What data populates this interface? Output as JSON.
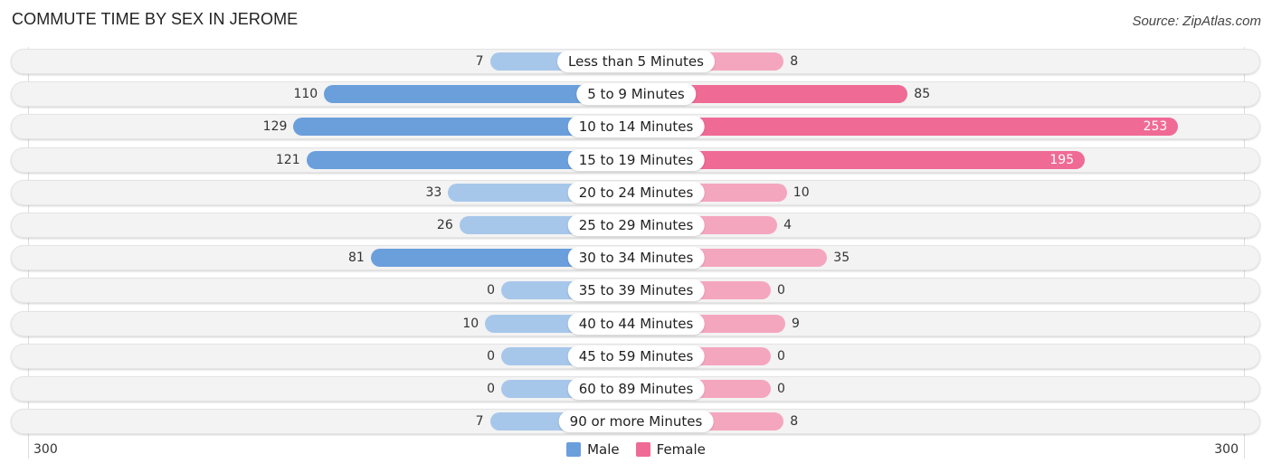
{
  "title": "COMMUTE TIME BY SEX IN JEROME",
  "source": "Source: ZipAtlas.com",
  "legend": [
    {
      "label": "Male",
      "color": "#6a9fdc"
    },
    {
      "label": "Female",
      "color": "#f06a96"
    }
  ],
  "axis": {
    "left_label": "300",
    "right_label": "300"
  },
  "chart_data": {
    "type": "bar",
    "orientation": "horizontal-diverging",
    "title": "COMMUTE TIME BY SEX IN JEROME",
    "xlabel": "",
    "ylabel": "",
    "xlim": [
      -300,
      300
    ],
    "tick_labels": [
      "300",
      "300"
    ],
    "legend_position": "bottom-center",
    "categories": [
      "Less than 5 Minutes",
      "5 to 9 Minutes",
      "10 to 14 Minutes",
      "15 to 19 Minutes",
      "20 to 24 Minutes",
      "25 to 29 Minutes",
      "30 to 34 Minutes",
      "35 to 39 Minutes",
      "40 to 44 Minutes",
      "45 to 59 Minutes",
      "60 to 89 Minutes",
      "90 or more Minutes"
    ],
    "series": [
      {
        "name": "Male",
        "color": "#6a9fdc",
        "values": [
          7,
          110,
          129,
          121,
          33,
          26,
          81,
          0,
          10,
          0,
          0,
          7
        ]
      },
      {
        "name": "Female",
        "color": "#f06a96",
        "values": [
          8,
          85,
          253,
          195,
          10,
          4,
          35,
          0,
          9,
          0,
          0,
          8
        ]
      }
    ]
  }
}
